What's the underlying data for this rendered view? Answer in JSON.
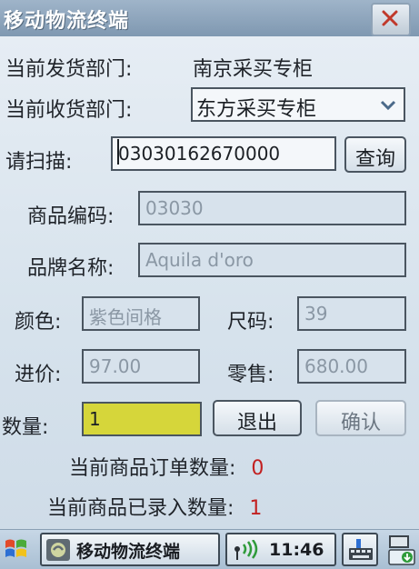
{
  "window": {
    "title": "移动物流终端"
  },
  "form": {
    "sender_dept_label": "当前发货部门:",
    "sender_dept_value": "南京采买专柜",
    "receiver_dept_label": "当前收货部门:",
    "receiver_dept_value": "东方采买专柜",
    "scan_label": "请扫描:",
    "scan_value": "03030162670000",
    "query_button": "查询",
    "product_code_label": "商品编码:",
    "product_code_value": "03030",
    "brand_label": "品牌名称:",
    "brand_value": "Aquila d'oro",
    "color_label": "颜色:",
    "color_value": "紫色间格",
    "size_label": "尺码:",
    "size_value": "39",
    "cost_label": "进价:",
    "cost_value": "97.00",
    "retail_label": "零售:",
    "retail_value": "680.00",
    "qty_label": "数量:",
    "qty_value": "1",
    "exit_button": "退出",
    "confirm_button": "确认",
    "order_qty_label": "当前商品订单数量:",
    "order_qty_value": "0",
    "entered_qty_label": "当前商品已录入数量:",
    "entered_qty_value": "1"
  },
  "taskbar": {
    "app_label": "移动物流终端",
    "clock": "11:46"
  },
  "colors": {
    "titlebar": "#8ea4ba",
    "quantity_field": "#d6d63a",
    "count_red": "#c22020"
  }
}
